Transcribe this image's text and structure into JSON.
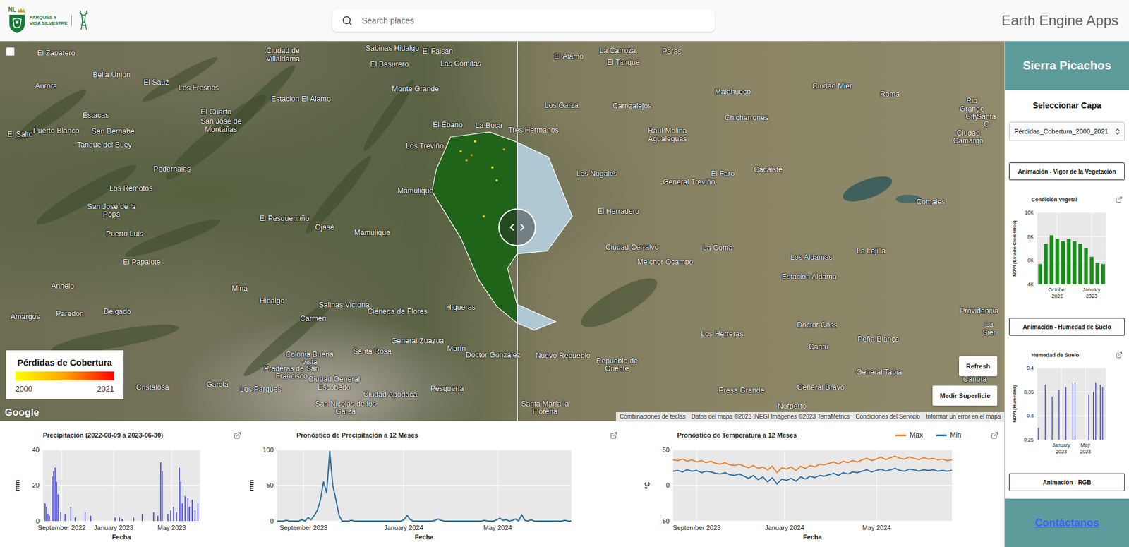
{
  "header": {
    "logo": {
      "badge": "NL",
      "lines": [
        "PARQUES Y",
        "VIDA SILVESTRE"
      ]
    },
    "search": {
      "placeholder": "Search places"
    },
    "app_title": "Earth Engine Apps"
  },
  "map": {
    "places": [
      "El Zapatero",
      "Bella Unión",
      "El Sauz",
      "Aurora",
      "Los Fresnos",
      "Estacas",
      "El Cuarto",
      "San José de Montañas",
      "El Salto",
      "Puerto Blanco",
      "San Bernabé",
      "Tanque del Buey",
      "Pedernales",
      "Los Remotos",
      "San José de la Popa",
      "El Pesquerinño",
      "Puerto Luis",
      "Ojasé",
      "Mamulique",
      "Mamulique",
      "El Papalote",
      "Anhelo",
      "Mina",
      "Hidalgo",
      "Salinas Victoria",
      "Amargos",
      "Paredón",
      "Delgado",
      "Carmen",
      "Ciénega de Flores",
      "Higueras",
      "General Zuazua",
      "Marín",
      "Doctor González",
      "Colonia Buena Vista",
      "Praderas de San Francisco",
      "Ciudad General Escobedo",
      "Santa Rosa",
      "Ciudad Apodaca",
      "Pesquería",
      "Cristalosa",
      "García",
      "Los Parques",
      "San Nicolás de los Garza",
      "Nuevo Repueblo",
      "Repueblo de Oriente",
      "Santa María la Floreña",
      "Ciudad de Villaldama",
      "Sabinas Hidalgo",
      "El Faisán",
      "El Basurero",
      "Las Comitas",
      "Estación El Álamo",
      "Monte Grande",
      "El Ébano",
      "La Boca",
      "Los Treviño",
      "Tres Hermanos",
      "El Álamo",
      "La Carroza",
      "El Tanque",
      "Paras",
      "Los Garza",
      "Carrizalejos",
      "Raúl Molina Agualeguas",
      "Malahueco",
      "Chicharrones",
      "Ciudad Mier",
      "Roma",
      "Rio Grande City",
      "Ciudad Camargo",
      "Los Nogales",
      "General Treviño",
      "El Faro",
      "Cacaiste",
      "El Herradero",
      "Ciudad Cerralvo",
      "Melchor Ocampo",
      "La Coma",
      "Comales",
      "Los Aldamas",
      "La Lajilla",
      "Estación Aldama",
      "Providencia",
      "Doctor Coss",
      "Los Herreras",
      "Cantú",
      "Peña Blanca",
      "La Carlota",
      "General Tapia",
      "Presa Grande",
      "General Bravo",
      "Norberto",
      "Santa C",
      "La Sier"
    ],
    "compare_slider": {
      "level": 0.515
    },
    "legend": {
      "title": "Pérdidas de Cobertura",
      "min": "2000",
      "max": "2021"
    },
    "buttons": [
      "Refresh",
      "Medir Superficie"
    ],
    "logo": "Google",
    "attribution": [
      "Combinaciones de teclas",
      "Datos del mapa ©2023 INEGI Imágenes ©2023 TerraMetrics",
      "Condiciones del Servicio",
      "Informar un error en el mapa"
    ]
  },
  "sidebar": {
    "title": "Sierra Picachos",
    "layer_label": "Seleccionar Capa",
    "layer_select": {
      "value": "Pérdidas_Cobertura_2000_2021"
    },
    "items": [
      {
        "kind": "button",
        "label": "Animación - Vigor de la Vegetación"
      },
      {
        "kind": "chart",
        "title": "Condición Vegetal",
        "y_label": "NDVI (Estado Clorofílico)",
        "y_ticks": [
          "4K",
          "6K",
          "8K",
          "10K"
        ],
        "x_ticks": [
          [
            "October",
            "2022"
          ],
          [
            "January",
            "2023"
          ]
        ],
        "series": [
          {
            "values": [
              5700,
              7400,
              8100,
              7800,
              7600,
              7800,
              7600,
              7400,
              7000,
              6300,
              5800,
              5700
            ]
          }
        ]
      },
      {
        "kind": "button",
        "label": "Animación - Humedad de Suelo"
      },
      {
        "kind": "chart",
        "title": "Humedad de Suelo",
        "y_label": "NDVI (Humedad)",
        "y_ticks": [
          "0.25",
          "0.3",
          "0.35",
          "0.4"
        ],
        "x_ticks": [
          [
            "January",
            "2023"
          ],
          [
            "May",
            "2023"
          ]
        ],
        "series": [
          {
            "values": [
              0.275,
              0,
              0,
              0.365,
              0,
              0,
              0.34,
              0,
              0,
              0.355,
              0,
              0,
              0.36,
              0,
              0,
              0.37,
              0.37,
              0,
              0,
              0,
              0,
              0,
              0.345,
              0,
              0.35,
              0.37,
              0,
              0.365,
              0.36,
              0
            ]
          }
        ]
      },
      {
        "kind": "button",
        "label": "Animación - RGB"
      }
    ],
    "contact": "Contáctanos"
  },
  "charts": [
    {
      "kind": "bar",
      "title": "Precipitación (2022-08-09 a 2023-06-30)",
      "y_label": "mm",
      "x_label": "Fecha",
      "y_ticks": [
        "0",
        "20",
        "40"
      ],
      "x_ticks": [
        [
          "September 2022"
        ],
        [
          "January 2023"
        ],
        [
          "May 2023"
        ]
      ],
      "series": [
        {
          "values": [
            0,
            10,
            8,
            4,
            3,
            0,
            25,
            28,
            30,
            22,
            15,
            0,
            5,
            0,
            0,
            4,
            0,
            0,
            0,
            8,
            0,
            0,
            2,
            0,
            0,
            0,
            0,
            0,
            0,
            5,
            0,
            0,
            0,
            3,
            0,
            0,
            0,
            0,
            0,
            0,
            0,
            0,
            0,
            0,
            0,
            0,
            0,
            0,
            0,
            0,
            2,
            0,
            0,
            2,
            0,
            1,
            0,
            0,
            0,
            0,
            0,
            0,
            0,
            2,
            0,
            0,
            0,
            0,
            0,
            4,
            0,
            0,
            0,
            0,
            0,
            0,
            0,
            5,
            0,
            0,
            3,
            0,
            33,
            28,
            0,
            0,
            0,
            4,
            0,
            6,
            0,
            8,
            0,
            5,
            0,
            30,
            22,
            10,
            0,
            14,
            0,
            13,
            8,
            0,
            12,
            0,
            6,
            0,
            10,
            0
          ]
        }
      ]
    },
    {
      "kind": "line",
      "title": "Pronóstico de Precipitación a 12 Meses",
      "y_label": "mm",
      "x_label": "Fecha",
      "y_ticks": [
        "0",
        "50",
        "100"
      ],
      "x_ticks": [
        [
          "September 2023"
        ],
        [
          "January 2024"
        ],
        [
          "May 2024"
        ]
      ],
      "series": [
        {
          "values": [
            0,
            0,
            0,
            1,
            0,
            0,
            0,
            0,
            2,
            0,
            5,
            2,
            8,
            15,
            30,
            55,
            40,
            98,
            50,
            30,
            8,
            0,
            0,
            0,
            1,
            0,
            0,
            0,
            0,
            0,
            0,
            0,
            0,
            0,
            0,
            0,
            0,
            0,
            0,
            0,
            0,
            2,
            8,
            2,
            0,
            0,
            0,
            0,
            0,
            0,
            0,
            1,
            3,
            1,
            0,
            0,
            0,
            0,
            0,
            0,
            0,
            0,
            0,
            0,
            0,
            0,
            0,
            1,
            0,
            0,
            0,
            2,
            4,
            1,
            2,
            0,
            1,
            3,
            0,
            9,
            1,
            0,
            2,
            0,
            0,
            0,
            0,
            0,
            0,
            0,
            0,
            0,
            0,
            1,
            0,
            0
          ]
        }
      ]
    },
    {
      "kind": "line",
      "title": "Pronóstico de Temperatura a 12 Meses",
      "y_label": "°C",
      "x_label": "Fecha",
      "y_ticks": [
        "-50",
        "0",
        "50"
      ],
      "x_ticks": [
        [
          "September 2023"
        ],
        [
          "January 2024"
        ],
        [
          "May 2024"
        ]
      ],
      "series": [
        {
          "name": "Max",
          "color": "#e8822a",
          "values": [
            36,
            35,
            37,
            34,
            36,
            33,
            35,
            32,
            34,
            31,
            30,
            32,
            29,
            28,
            30,
            27,
            25,
            28,
            24,
            26,
            22,
            27,
            18,
            25,
            23,
            26,
            21,
            27,
            24,
            28,
            26,
            30,
            29,
            31,
            33,
            30,
            34,
            32,
            35,
            33,
            36,
            38,
            35,
            37,
            40,
            36,
            39,
            41,
            38,
            37,
            40,
            38,
            36,
            39,
            37,
            38,
            36,
            37,
            35,
            36
          ]
        },
        {
          "name": "Min",
          "color": "#2e6da4",
          "values": [
            20,
            21,
            19,
            22,
            20,
            21,
            18,
            20,
            19,
            17,
            16,
            18,
            15,
            14,
            16,
            13,
            10,
            14,
            8,
            12,
            5,
            11,
            2,
            9,
            7,
            10,
            6,
            12,
            9,
            13,
            11,
            14,
            13,
            15,
            17,
            14,
            18,
            16,
            19,
            18,
            20,
            22,
            19,
            21,
            23,
            20,
            22,
            24,
            21,
            20,
            23,
            22,
            20,
            22,
            21,
            22,
            20,
            21,
            20,
            21
          ]
        }
      ]
    }
  ]
}
